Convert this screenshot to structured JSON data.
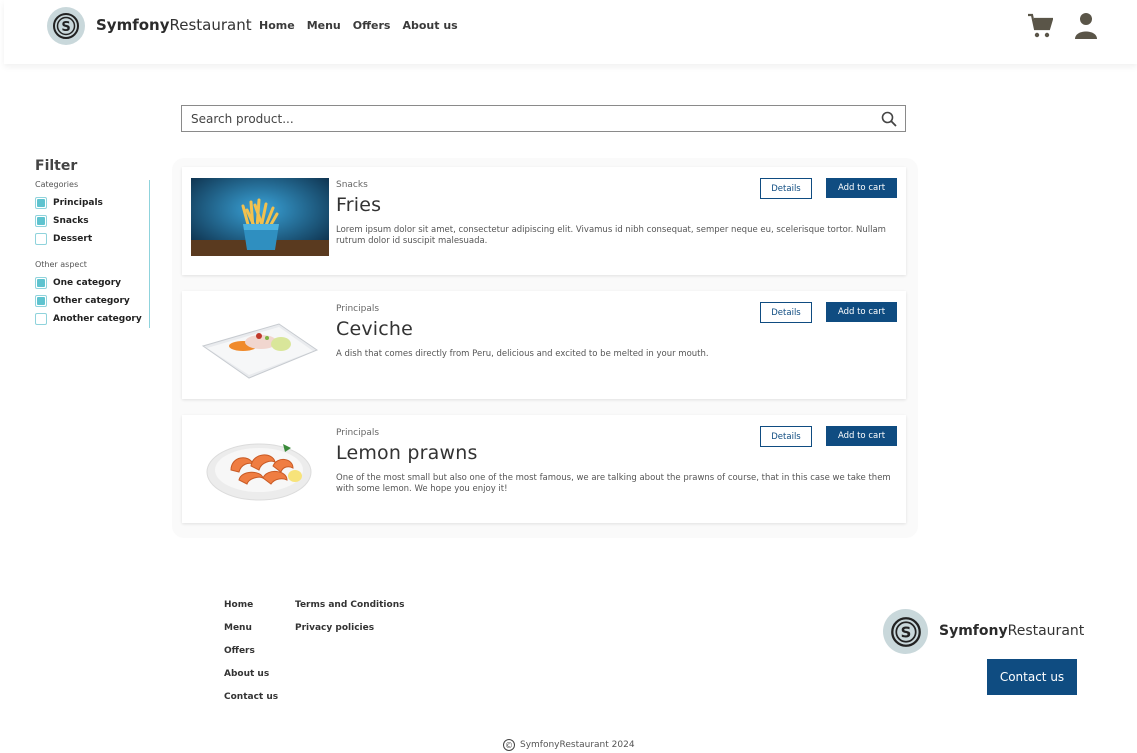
{
  "header": {
    "brand_bold": "Symfony",
    "brand_rest": "Restaurant",
    "nav": [
      "Home",
      "Menu",
      "Offers",
      "About us"
    ]
  },
  "search": {
    "placeholder": "Search product..."
  },
  "filter": {
    "title": "Filter",
    "groups": [
      {
        "label": "Categories",
        "items": [
          {
            "label": "Principals",
            "checked": true
          },
          {
            "label": "Snacks",
            "checked": true
          },
          {
            "label": "Dessert",
            "checked": false
          }
        ]
      },
      {
        "label": "Other aspect",
        "items": [
          {
            "label": "One category",
            "checked": true
          },
          {
            "label": "Other category",
            "checked": true
          },
          {
            "label": "Another category",
            "checked": false
          }
        ]
      }
    ]
  },
  "products": [
    {
      "category": "Snacks",
      "name": "Fries",
      "description": "Lorem ipsum dolor sit amet, consectetur adipiscing elit. Vivamus id nibh consequat, semper neque eu, scelerisque tortor. Nullam rutrum dolor id suscipit malesuada.",
      "image": "fries-photo",
      "details_label": "Details",
      "cart_label": "Add to cart"
    },
    {
      "category": "Principals",
      "name": "Ceviche",
      "description": "A dish that comes directly from Peru, delicious and excited to be melted in your mouth.",
      "image": "ceviche-photo",
      "details_label": "Details",
      "cart_label": "Add to cart"
    },
    {
      "category": "Principals",
      "name": "Lemon prawns",
      "description": "One of the most small but also one of the most famous, we are talking about the prawns of course, that in this case we take them with some lemon. We hope you enjoy it!",
      "image": "prawns-photo",
      "details_label": "Details",
      "cart_label": "Add to cart"
    }
  ],
  "footer": {
    "links_col1": [
      "Home",
      "Menu",
      "Offers",
      "About us",
      "Contact us"
    ],
    "links_col2": [
      "Terms and Conditions",
      "Privacy policies"
    ],
    "brand_bold": "Symfony",
    "brand_rest": "Restaurant",
    "contact_button": "Contact us",
    "copyright": "SymfonyRestaurant 2024"
  },
  "colors": {
    "primary": "#0f4c81",
    "accent": "#5fc3cf",
    "logo_bg": "#c9d8db"
  }
}
